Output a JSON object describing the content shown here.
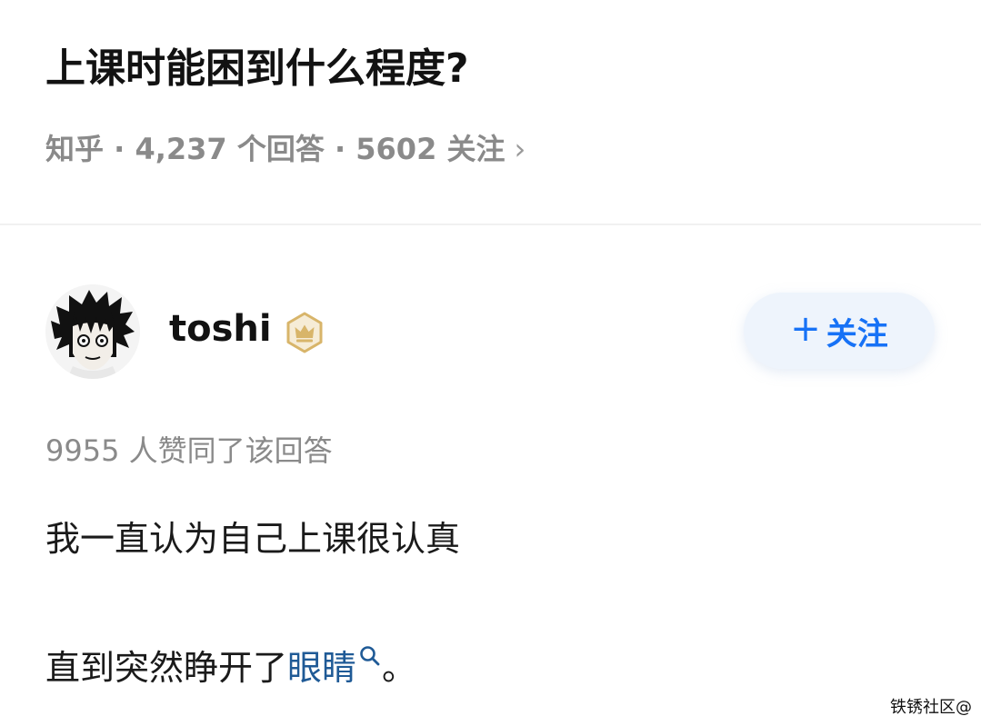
{
  "question": {
    "title": "上课时能困到什么程度?",
    "source": "知乎",
    "answers_count": "4,237 个回答",
    "followers": "5602 关注",
    "separator": " · ",
    "chevron": "›"
  },
  "author": {
    "name": "toshi",
    "badge_icon": "crown-badge-icon",
    "avatar_icon": "cartoon-avatar"
  },
  "follow_button": {
    "plus": "+",
    "label": "关注"
  },
  "answer": {
    "upvote_text": "9955 人赞同了该回答",
    "line_1": "我一直认为自己上课很认真",
    "line_2_prefix": "直到突然睁开了",
    "line_2_link": "眼睛",
    "line_2_suffix": "。"
  },
  "watermark": "铁锈社区@",
  "colors": {
    "title": "#121212",
    "meta": "#8a8a8a",
    "accent_blue": "#1772f6",
    "link_blue": "#1f5a96",
    "badge_gold": "#d8b56a",
    "follow_bg": "#eef4fc"
  }
}
